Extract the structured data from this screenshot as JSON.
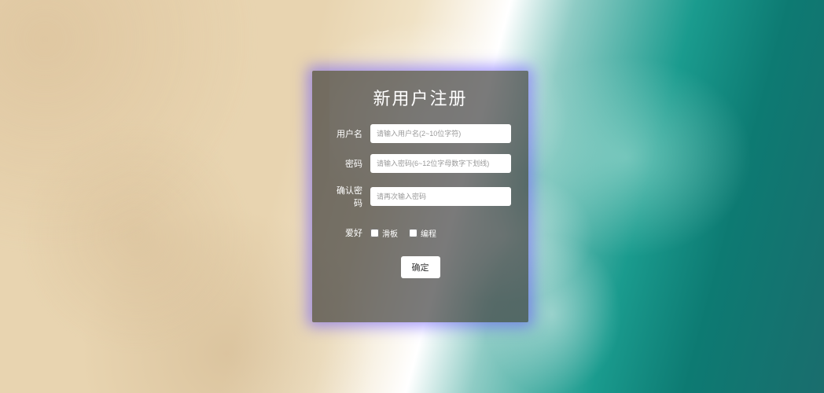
{
  "form": {
    "title": "新用户注册",
    "username": {
      "label": "用户名",
      "placeholder": "请输入用户名(2~10位字符)",
      "value": ""
    },
    "password": {
      "label": "密码",
      "placeholder": "请输入密码(6~12位字母数字下划线)",
      "value": ""
    },
    "confirmPassword": {
      "label": "确认密码",
      "placeholder": "请再次输入密码",
      "value": ""
    },
    "hobbies": {
      "label": "爱好",
      "options": {
        "skateboard": "滑板",
        "programming": "编程"
      }
    },
    "submit": "确定"
  }
}
